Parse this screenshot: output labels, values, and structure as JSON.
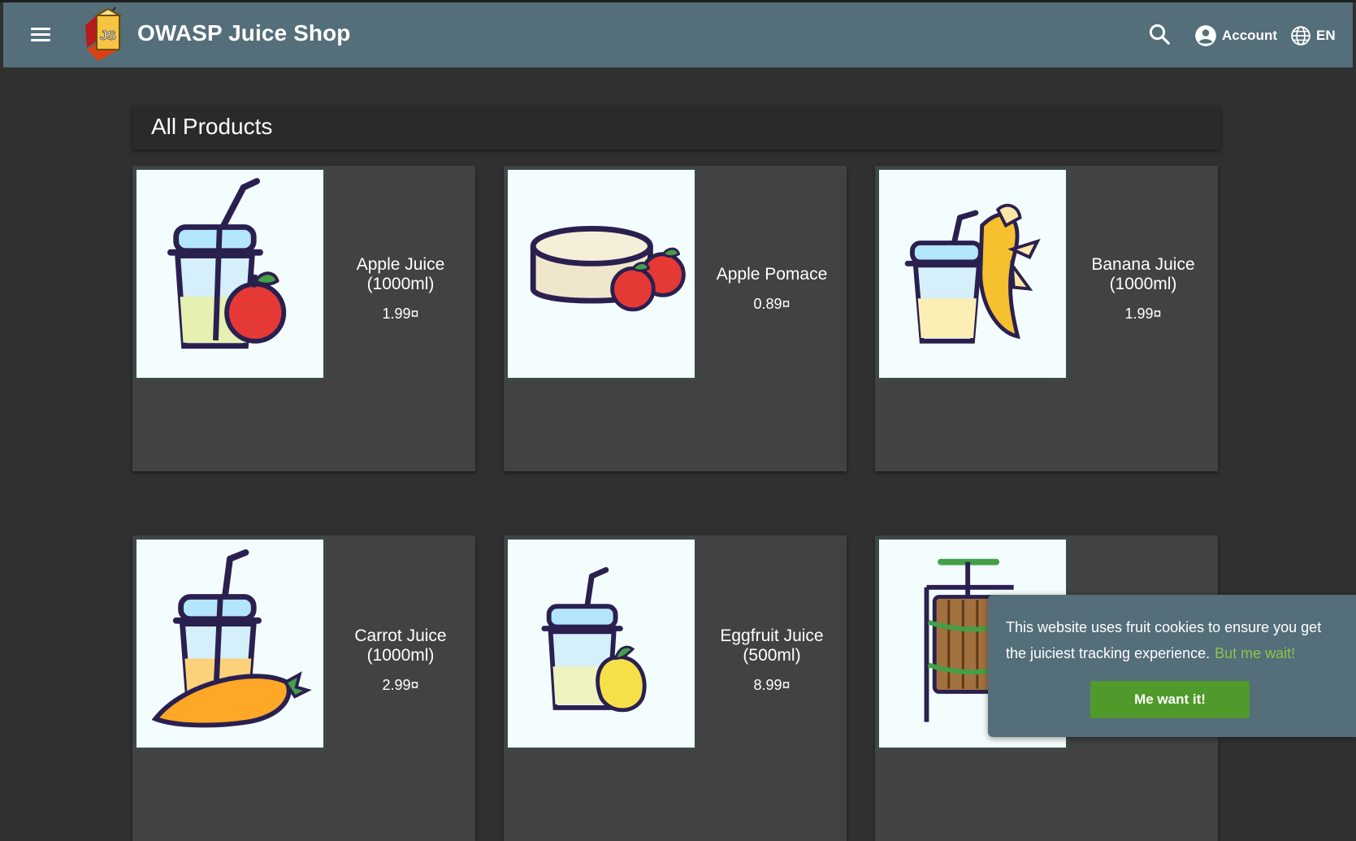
{
  "app": {
    "title": "OWASP Juice Shop"
  },
  "toolbar": {
    "menu_icon": "menu-icon",
    "search_icon": "search-icon",
    "account_label": "Account",
    "language_label": "EN",
    "background": "#546e7a"
  },
  "main": {
    "heading": "All Products"
  },
  "products": [
    {
      "name": "Apple Juice (1000ml)",
      "price": "1.99¤",
      "image": "apple-juice-icon"
    },
    {
      "name": "Apple Pomace",
      "price": "0.89¤",
      "image": "apple-pomace-icon"
    },
    {
      "name": "Banana Juice (1000ml)",
      "price": "1.99¤",
      "image": "banana-juice-icon"
    },
    {
      "name": "Carrot Juice (1000ml)",
      "price": "2.99¤",
      "image": "carrot-juice-icon"
    },
    {
      "name": "Eggfruit Juice (500ml)",
      "price": "8.99¤",
      "image": "eggfruit-juice-icon"
    },
    {
      "name": "",
      "price": "",
      "image": "fruit-press-icon"
    }
  ],
  "cookie_banner": {
    "message": "This website uses fruit cookies to ensure you get the juiciest tracking experience.",
    "learn_more": "But me wait!",
    "accept_label": "Me want it!",
    "accent": "#8bc34a",
    "button_color": "#4f9a2a"
  }
}
